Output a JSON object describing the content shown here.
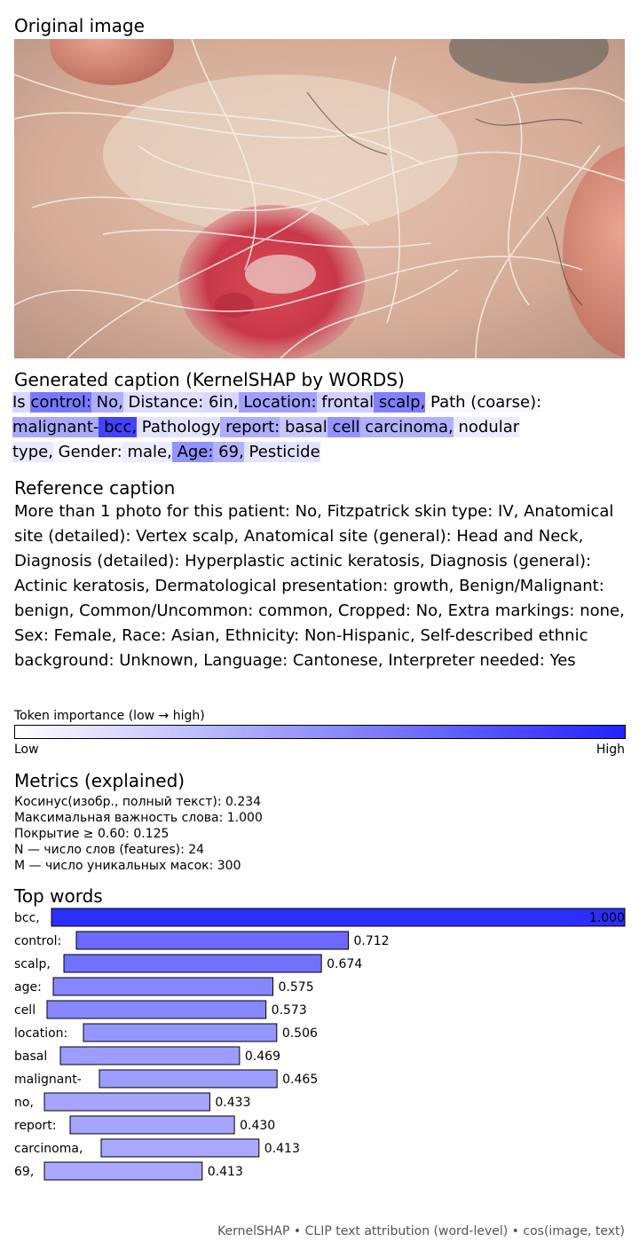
{
  "sections": {
    "original_image": "Original image",
    "generated_caption": "Generated caption (KernelSHAP by WORDS)",
    "reference_caption": "Reference caption",
    "metrics": "Metrics (explained)",
    "top_words": "Top words"
  },
  "generated_tokens": [
    {
      "text": "Is ",
      "w": 0.22
    },
    {
      "text": "control:",
      "w": 0.712
    },
    {
      "text": " No,",
      "w": 0.433
    },
    {
      "text": " Distance:",
      "w": 0.18
    },
    {
      "text": " 6in,",
      "w": 0.2
    },
    {
      "text": " Location:",
      "w": 0.506
    },
    {
      "text": " frontal",
      "w": 0.25
    },
    {
      "text": " scalp,",
      "w": 0.674
    },
    {
      "text": " Path (coarse):",
      "w": 0.04
    },
    {
      "text": "malignant-",
      "w": 0.465
    },
    {
      "text": " bcc,",
      "w": 1.0
    },
    {
      "text": " Pathology",
      "w": 0.15
    },
    {
      "text": " report:",
      "w": 0.43
    },
    {
      "text": " basal",
      "w": 0.3
    },
    {
      "text": " cell",
      "w": 0.573
    },
    {
      "text": " carcinoma,",
      "w": 0.413
    },
    {
      "text": " nodular",
      "w": 0.1
    },
    {
      "text": "type,",
      "w": 0.12
    },
    {
      "text": " Gender:",
      "w": 0.05
    },
    {
      "text": " male,",
      "w": 0.1
    },
    {
      "text": " Age:",
      "w": 0.575
    },
    {
      "text": " 69,",
      "w": 0.413
    },
    {
      "text": " Pesticide",
      "w": 0.15
    }
  ],
  "reference_caption": "More than 1 photo for this patient: No, Fitzpatrick skin type: IV, Anatomical site (detailed): Vertex scalp, Anatomical site (general): Head and Neck, Diagnosis (detailed): Hyperplastic actinic keratosis, Diagnosis (general): Actinic keratosis, Dermatological presentation: growth, Benign/Malignant: benign, Common/Uncommon: common, Cropped: No, Extra markings: none, Sex: Female, Race: Asian, Ethnicity: Non-Hispanic, Self-described ethnic background: Unknown, Language: Cantonese, Interpreter needed: Yes",
  "colorbar": {
    "title": "Token importance (low → high)",
    "low": "Low",
    "high": "High",
    "color_low": "#ffffff",
    "color_high": "#2222ff"
  },
  "metrics": [
    "Косинус(изобр., полный текст): 0.234",
    "Максимальная важность слова: 1.000",
    "Покрытие ≥ 0.60: 0.125",
    "N — число слов (features): 24",
    "M — число уникальных масок: 300"
  ],
  "chart_data": {
    "type": "bar",
    "orientation": "horizontal",
    "title": "Top words",
    "categories": [
      "bcc,",
      "control:",
      "scalp,",
      "age:",
      "cell",
      "location:",
      "basal",
      "malignant-",
      "no,",
      "report:",
      "carcinoma,",
      "69,"
    ],
    "values": [
      1.0,
      0.712,
      0.674,
      0.575,
      0.573,
      0.506,
      0.469,
      0.465,
      0.433,
      0.43,
      0.413,
      0.413
    ],
    "labels": [
      "1.000",
      "0.712",
      "0.674",
      "0.575",
      "0.573",
      "0.506",
      "0.469",
      "0.465",
      "0.433",
      "0.430",
      "0.413",
      "0.413"
    ],
    "xlim": [
      0,
      1
    ],
    "color_low": "#ffffff",
    "color_high": "#2222ff"
  },
  "footer": "KernelSHAP • CLIP text attribution (word-level) • cos(image, text)"
}
